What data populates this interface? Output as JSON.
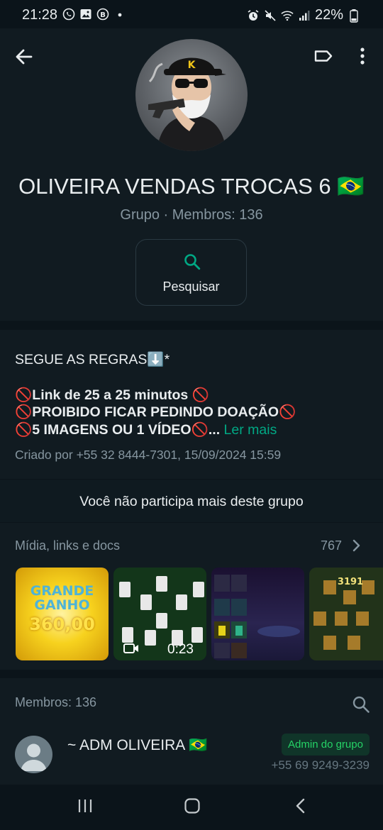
{
  "status_bar": {
    "time": "21:28",
    "battery": "22%",
    "left_icons": [
      "whatsapp-icon",
      "gallery-icon",
      "b-icon",
      "dot-icon"
    ],
    "right_icons": [
      "alarm-icon",
      "mute-icon",
      "wifi-icon",
      "signal-icon",
      "battery-icon"
    ]
  },
  "header": {
    "title": "OLIVEIRA VENDAS TROCAS 6 🇧🇷",
    "subtitle": "Grupo · Membros: 136",
    "avatar_letter": "K",
    "search_label": "Pesquisar"
  },
  "description": {
    "line1": "SEGUE AS REGRAS⬇️*",
    "line2": "🚫Link de  25 a 25 minutos 🚫",
    "line3": "🚫PROIBIDO FICAR PEDINDO DOAÇÃO🚫",
    "line4": "🚫5 IMAGENS OU 1 VÍDEO🚫...",
    "read_more": "Ler mais",
    "created": "Criado por +55 32 8444-7301, 15/09/2024 15:59"
  },
  "notice": "Você não participa mais deste grupo",
  "media": {
    "title": "Mídia, links e docs",
    "count": "767",
    "thumb1_line1": "GRANDE",
    "thumb1_line2": "GANHO",
    "thumb1_value": "360,00",
    "thumb2_duration": "0:23",
    "thumb4_number": "3191"
  },
  "members": {
    "title": "Membros: 136",
    "items": [
      {
        "name": "~ ADM OLIVEIRA 🇧🇷",
        "badge": "Admin do grupo",
        "phone": "+55 69 9249-3239"
      }
    ]
  },
  "colors": {
    "background": "#0b141a",
    "panel": "#111b21",
    "accent": "#00a884",
    "badge_bg": "#103529",
    "badge_text": "#25d366",
    "secondary_text": "#8696a0"
  }
}
